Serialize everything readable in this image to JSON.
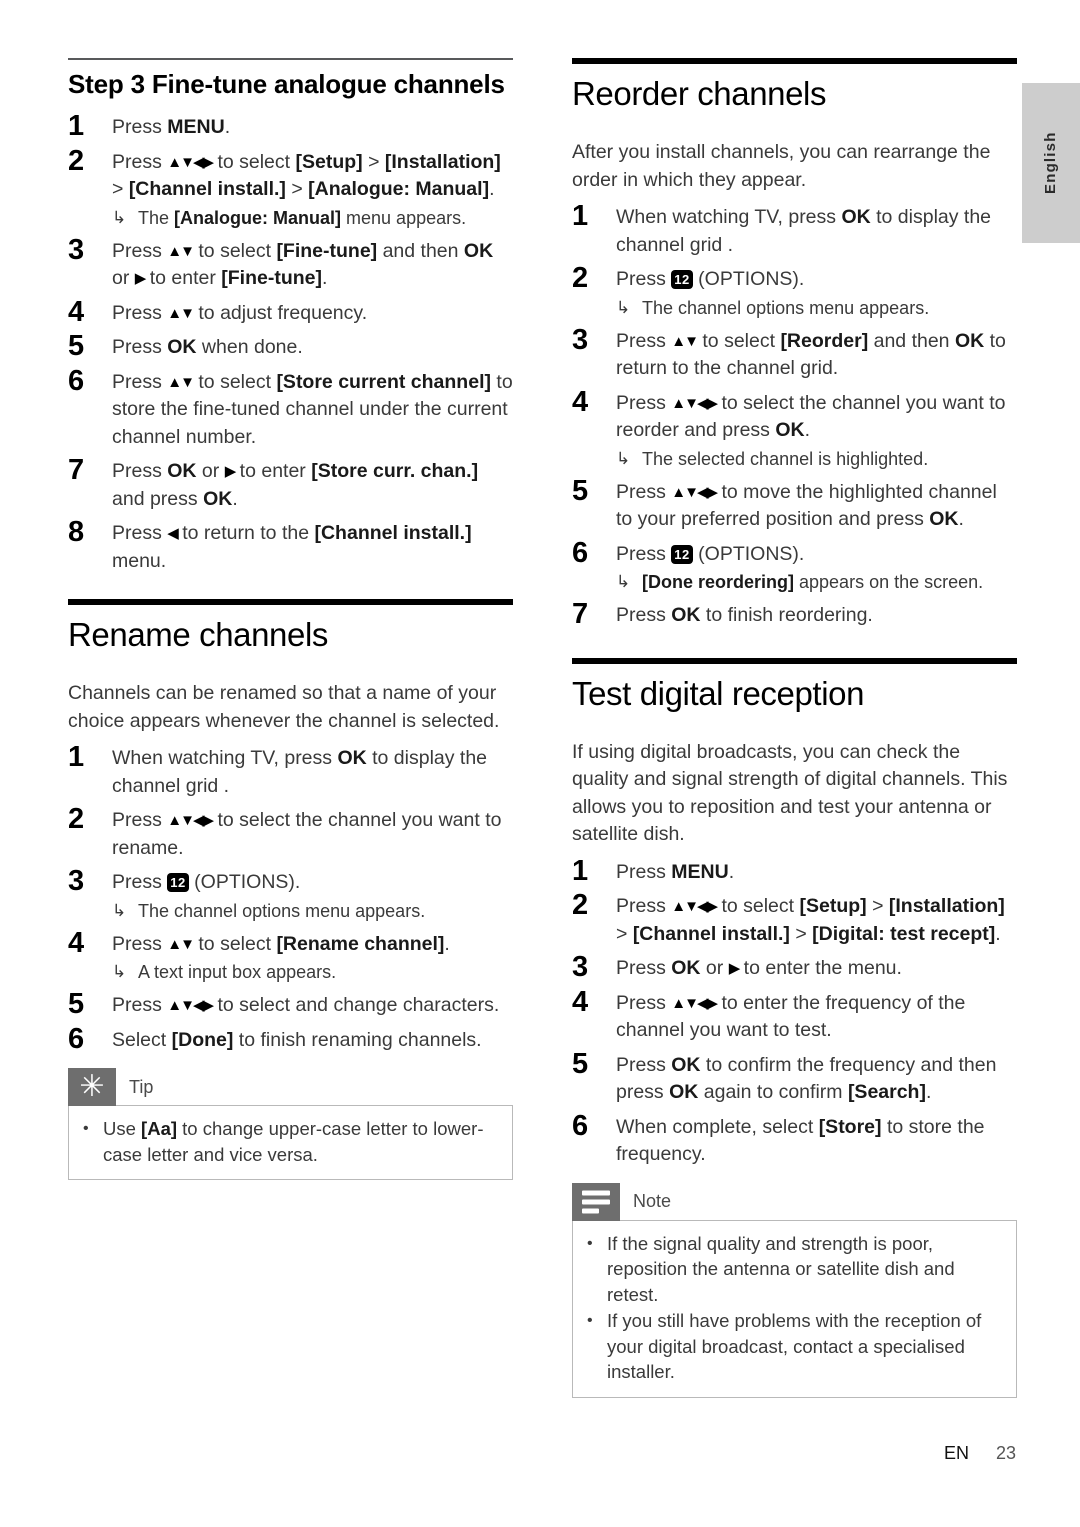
{
  "page": {
    "language_tab": "English",
    "footer_locale": "EN",
    "footer_page_number": "23"
  },
  "icons": {
    "options_key": "12",
    "nav_updown": "▲▼",
    "nav_all": "▲▼◀▶",
    "nav_right": "▶",
    "nav_left": "◀",
    "result_arrow": "↳",
    "bullet": "•",
    "tip_icon": "asterisk-icon",
    "note_icon": "note-lines-icon"
  },
  "left_column": {
    "section_finetune": {
      "rule": "thin",
      "heading": "Step 3 Fine-tune analogue channels",
      "steps": [
        {
          "num": "1",
          "parts": [
            {
              "t": "Press ",
              "s": "n"
            },
            {
              "t": "MENU",
              "s": "b"
            },
            {
              "t": ".",
              "s": "n"
            }
          ]
        },
        {
          "num": "2",
          "parts": [
            {
              "t": "Press ",
              "s": "n"
            },
            {
              "t": "▲▼◀▶",
              "s": "k"
            },
            {
              "t": " to select ",
              "s": "n"
            },
            {
              "t": "[Setup]",
              "s": "b"
            },
            {
              "t": " > ",
              "s": "n"
            },
            {
              "t": "[Installation]",
              "s": "b"
            },
            {
              "t": " > ",
              "s": "n"
            },
            {
              "t": "[Channel install.]",
              "s": "b"
            },
            {
              "t": " > ",
              "s": "n"
            },
            {
              "t": "[Analogue: Manual]",
              "s": "b"
            },
            {
              "t": ".",
              "s": "n"
            }
          ],
          "results": [
            [
              {
                "t": "The ",
                "s": "n"
              },
              {
                "t": "[Analogue: Manual]",
                "s": "b"
              },
              {
                "t": " menu appears.",
                "s": "n"
              }
            ]
          ]
        },
        {
          "num": "3",
          "parts": [
            {
              "t": "Press ",
              "s": "n"
            },
            {
              "t": "▲▼",
              "s": "k"
            },
            {
              "t": " to select ",
              "s": "n"
            },
            {
              "t": "[Fine-tune]",
              "s": "b"
            },
            {
              "t": " and then ",
              "s": "n"
            },
            {
              "t": "OK",
              "s": "b"
            },
            {
              "t": " or ",
              "s": "n"
            },
            {
              "t": "▶",
              "s": "k"
            },
            {
              "t": " to enter ",
              "s": "n"
            },
            {
              "t": "[Fine-tune]",
              "s": "b"
            },
            {
              "t": ".",
              "s": "n"
            }
          ]
        },
        {
          "num": "4",
          "parts": [
            {
              "t": "Press ",
              "s": "n"
            },
            {
              "t": "▲▼",
              "s": "k"
            },
            {
              "t": " to adjust frequency.",
              "s": "n"
            }
          ]
        },
        {
          "num": "5",
          "parts": [
            {
              "t": "Press ",
              "s": "n"
            },
            {
              "t": "OK",
              "s": "b"
            },
            {
              "t": " when done.",
              "s": "n"
            }
          ]
        },
        {
          "num": "6",
          "parts": [
            {
              "t": "Press ",
              "s": "n"
            },
            {
              "t": "▲▼",
              "s": "k"
            },
            {
              "t": " to select ",
              "s": "n"
            },
            {
              "t": "[Store current channel]",
              "s": "b"
            },
            {
              "t": " to store the fine-tuned channel under the current channel number.",
              "s": "n"
            }
          ]
        },
        {
          "num": "7",
          "parts": [
            {
              "t": "Press ",
              "s": "n"
            },
            {
              "t": "OK",
              "s": "b"
            },
            {
              "t": " or ",
              "s": "n"
            },
            {
              "t": "▶",
              "s": "k"
            },
            {
              "t": " to enter ",
              "s": "n"
            },
            {
              "t": "[Store curr. chan.]",
              "s": "b"
            },
            {
              "t": " and press ",
              "s": "n"
            },
            {
              "t": "OK",
              "s": "b"
            },
            {
              "t": ".",
              "s": "n"
            }
          ]
        },
        {
          "num": "8",
          "parts": [
            {
              "t": "Press ",
              "s": "n"
            },
            {
              "t": "◀",
              "s": "k"
            },
            {
              "t": " to return to the ",
              "s": "n"
            },
            {
              "t": "[Channel install.]",
              "s": "b"
            },
            {
              "t": " menu.",
              "s": "n"
            }
          ]
        }
      ]
    },
    "section_rename": {
      "rule": "thick",
      "heading": "Rename channels",
      "intro": "Channels can be renamed so that a name of your choice appears whenever the channel is selected.",
      "steps": [
        {
          "num": "1",
          "parts": [
            {
              "t": "When watching TV, press ",
              "s": "n"
            },
            {
              "t": "OK",
              "s": "b"
            },
            {
              "t": " to display the channel grid .",
              "s": "n"
            }
          ]
        },
        {
          "num": "2",
          "parts": [
            {
              "t": "Press ",
              "s": "n"
            },
            {
              "t": "▲▼◀▶",
              "s": "k"
            },
            {
              "t": " to select the channel you want to rename.",
              "s": "n"
            }
          ]
        },
        {
          "num": "3",
          "parts": [
            {
              "t": "Press  ",
              "s": "n"
            },
            {
              "t": "12",
              "s": "o"
            },
            {
              "t": " (OPTIONS).",
              "s": "n"
            }
          ],
          "results": [
            [
              {
                "t": "The channel options menu appears.",
                "s": "n"
              }
            ]
          ]
        },
        {
          "num": "4",
          "parts": [
            {
              "t": "Press ",
              "s": "n"
            },
            {
              "t": "▲▼",
              "s": "k"
            },
            {
              "t": " to select ",
              "s": "n"
            },
            {
              "t": "[Rename channel]",
              "s": "b"
            },
            {
              "t": ".",
              "s": "n"
            }
          ],
          "results": [
            [
              {
                "t": "A text input box appears.",
                "s": "n"
              }
            ]
          ]
        },
        {
          "num": "5",
          "parts": [
            {
              "t": "Press ",
              "s": "n"
            },
            {
              "t": "▲▼◀▶",
              "s": "k"
            },
            {
              "t": " to select and change characters.",
              "s": "n"
            }
          ]
        },
        {
          "num": "6",
          "parts": [
            {
              "t": "Select ",
              "s": "n"
            },
            {
              "t": "[Done]",
              "s": "b"
            },
            {
              "t": " to finish renaming channels.",
              "s": "n"
            }
          ]
        }
      ],
      "tip": {
        "title": "Tip",
        "items": [
          [
            {
              "t": "Use ",
              "s": "n"
            },
            {
              "t": "[Aa]",
              "s": "b"
            },
            {
              "t": " to change upper-case letter to lower-case letter and vice versa.",
              "s": "n"
            }
          ]
        ]
      }
    }
  },
  "right_column": {
    "section_reorder": {
      "rule": "thick",
      "heading": "Reorder channels",
      "intro": "After you install channels, you can rearrange the order in which they appear.",
      "steps": [
        {
          "num": "1",
          "parts": [
            {
              "t": "When watching TV, press ",
              "s": "n"
            },
            {
              "t": "OK",
              "s": "b"
            },
            {
              "t": " to display the channel grid .",
              "s": "n"
            }
          ]
        },
        {
          "num": "2",
          "parts": [
            {
              "t": "Press ",
              "s": "n"
            },
            {
              "t": "12",
              "s": "o"
            },
            {
              "t": " (OPTIONS).",
              "s": "n"
            }
          ],
          "results": [
            [
              {
                "t": "The channel options menu appears.",
                "s": "n"
              }
            ]
          ]
        },
        {
          "num": "3",
          "parts": [
            {
              "t": "Press ",
              "s": "n"
            },
            {
              "t": "▲▼",
              "s": "k"
            },
            {
              "t": " to select ",
              "s": "n"
            },
            {
              "t": "[Reorder]",
              "s": "b"
            },
            {
              "t": " and then ",
              "s": "n"
            },
            {
              "t": "OK",
              "s": "b"
            },
            {
              "t": " to return to the channel grid.",
              "s": "n"
            }
          ]
        },
        {
          "num": "4",
          "parts": [
            {
              "t": "Press ",
              "s": "n"
            },
            {
              "t": "▲▼◀▶",
              "s": "k"
            },
            {
              "t": " to select the channel you want to reorder and press ",
              "s": "n"
            },
            {
              "t": "OK",
              "s": "b"
            },
            {
              "t": ".",
              "s": "n"
            }
          ],
          "results": [
            [
              {
                "t": "The selected channel is highlighted.",
                "s": "n"
              }
            ]
          ]
        },
        {
          "num": "5",
          "parts": [
            {
              "t": "Press ",
              "s": "n"
            },
            {
              "t": "▲▼◀▶",
              "s": "k"
            },
            {
              "t": " to move the highlighted channel to your preferred position and press ",
              "s": "n"
            },
            {
              "t": "OK",
              "s": "b"
            },
            {
              "t": ".",
              "s": "n"
            }
          ]
        },
        {
          "num": "6",
          "parts": [
            {
              "t": "Press ",
              "s": "n"
            },
            {
              "t": "12",
              "s": "o"
            },
            {
              "t": " (OPTIONS).",
              "s": "n"
            }
          ],
          "results": [
            [
              {
                "t": "[Done reordering]",
                "s": "b"
              },
              {
                "t": " appears on the screen.",
                "s": "n"
              }
            ]
          ]
        },
        {
          "num": "7",
          "parts": [
            {
              "t": "Press ",
              "s": "n"
            },
            {
              "t": "OK",
              "s": "b"
            },
            {
              "t": " to finish reordering.",
              "s": "n"
            }
          ]
        }
      ]
    },
    "section_test": {
      "rule": "thick",
      "heading": "Test digital reception",
      "intro": "If using digital broadcasts, you can check the quality and signal strength of digital channels. This allows you to reposition and test your antenna or satellite dish.",
      "steps": [
        {
          "num": "1",
          "parts": [
            {
              "t": "Press ",
              "s": "n"
            },
            {
              "t": "MENU",
              "s": "b"
            },
            {
              "t": ".",
              "s": "n"
            }
          ]
        },
        {
          "num": "2",
          "parts": [
            {
              "t": "Press ",
              "s": "n"
            },
            {
              "t": "▲▼◀▶",
              "s": "k"
            },
            {
              "t": " to select ",
              "s": "n"
            },
            {
              "t": "[Setup]",
              "s": "b"
            },
            {
              "t": " > ",
              "s": "n"
            },
            {
              "t": "[Installation]",
              "s": "b"
            },
            {
              "t": " > ",
              "s": "n"
            },
            {
              "t": "[Channel install.]",
              "s": "b"
            },
            {
              "t": " > ",
              "s": "n"
            },
            {
              "t": "[Digital: test recept]",
              "s": "b"
            },
            {
              "t": ".",
              "s": "n"
            }
          ]
        },
        {
          "num": "3",
          "parts": [
            {
              "t": "Press ",
              "s": "n"
            },
            {
              "t": "OK",
              "s": "b"
            },
            {
              "t": " or ",
              "s": "n"
            },
            {
              "t": "▶",
              "s": "k"
            },
            {
              "t": " to enter the menu.",
              "s": "n"
            }
          ]
        },
        {
          "num": "4",
          "parts": [
            {
              "t": "Press ",
              "s": "n"
            },
            {
              "t": "▲▼◀▶",
              "s": "k"
            },
            {
              "t": " to enter the frequency of the channel you want to test.",
              "s": "n"
            }
          ]
        },
        {
          "num": "5",
          "parts": [
            {
              "t": "Press ",
              "s": "n"
            },
            {
              "t": "OK",
              "s": "b"
            },
            {
              "t": " to confirm the frequency and then press ",
              "s": "n"
            },
            {
              "t": "OK",
              "s": "b"
            },
            {
              "t": " again to confirm ",
              "s": "n"
            },
            {
              "t": "[Search]",
              "s": "b"
            },
            {
              "t": ".",
              "s": "n"
            }
          ]
        },
        {
          "num": "6",
          "parts": [
            {
              "t": "When complete, select ",
              "s": "n"
            },
            {
              "t": "[Store]",
              "s": "b"
            },
            {
              "t": " to store the frequency.",
              "s": "n"
            }
          ]
        }
      ],
      "note": {
        "title": "Note",
        "items": [
          [
            {
              "t": "If the signal quality and strength is poor, reposition the antenna or satellite dish and retest.",
              "s": "n"
            }
          ],
          [
            {
              "t": "If you still have problems with the reception of your digital broadcast, contact a specialised installer.",
              "s": "n"
            }
          ]
        ]
      }
    }
  }
}
